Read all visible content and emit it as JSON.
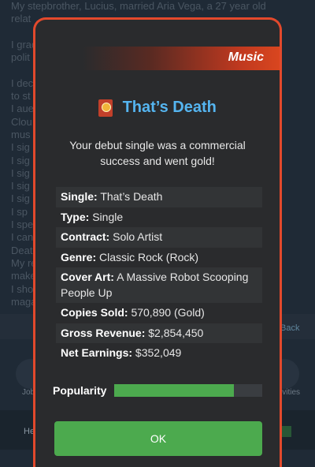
{
  "background": {
    "text": "My stepbrother, Lucius, married Aria Vega, a 27 year old\nrelat\n\nI grad\npolit\n\nI deci\nto st\nI aue\nClou\nmus\nI sig\nI sig\nI sig\nI sig\nI sig\nI sp\nI spe\nI can\nDeat\nMy re\nmake\nI sho\nmaga",
    "back_label": "Back",
    "left_label": "Job",
    "right_label": "ivities",
    "bottom_label": "He"
  },
  "modal": {
    "category": "Music",
    "title": "That’s Death",
    "subtitle": "Your debut single was a commercial success and went gold!",
    "details": [
      {
        "key": "Single:",
        "value": "That’s Death"
      },
      {
        "key": "Type:",
        "value": "Single"
      },
      {
        "key": "Contract:",
        "value": "Solo Artist"
      },
      {
        "key": "Genre:",
        "value": "Classic Rock (Rock)"
      },
      {
        "key": "Cover Art:",
        "value": "A Massive Robot Scooping People Up"
      },
      {
        "key": "Copies Sold:",
        "value": "570,890 (Gold)"
      },
      {
        "key": "Gross Revenue:",
        "value": "$2,854,450"
      },
      {
        "key": "Net Earnings:",
        "value": "$352,049"
      }
    ],
    "popularity_label": "Popularity",
    "popularity_fraction": 0.81,
    "ok_label": "OK"
  },
  "colors": {
    "accent": "#e2492c",
    "title": "#55b5f0",
    "popularity_fill": "#4caa4e",
    "ok_button": "#4caa4e"
  },
  "icons": {
    "title_icon": "gold-record-icon"
  }
}
